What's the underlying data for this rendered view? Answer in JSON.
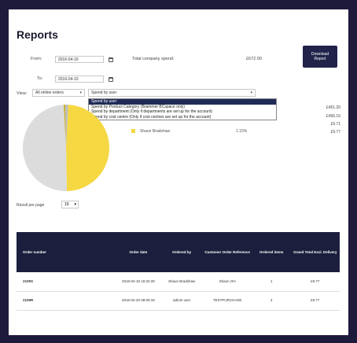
{
  "page": {
    "title": "Reports"
  },
  "filters": {
    "from_label": "From:",
    "from_value": "2016-04-10",
    "to_label": "To:",
    "to_value": "2016-04-10",
    "total_spend_label": "Total company spend:",
    "total_spend_value": "£672.00",
    "download_label": "Download Report",
    "view_label": "View:",
    "view_value": "All online orders",
    "spend_value": "Spend by user"
  },
  "dropdown": {
    "options": [
      "Spend by user",
      "Spend by Product Category (Brammer BCspace only)",
      "Spend by department (Only if departments are set up for the account)",
      "Spend by cost centre (Only if cost centres are set up for the account)"
    ],
    "selected_index": 0
  },
  "breakdown": {
    "amounts": [
      "£451.20",
      "£456.16",
      "£9.71",
      "£9.77"
    ],
    "legend_name": "Shaun Bradshaw",
    "legend_pct": "1.15%"
  },
  "chart_data": {
    "type": "pie",
    "slices": [
      {
        "label": "",
        "value": 48.9,
        "color": "#f5d842"
      },
      {
        "label": "",
        "value": 49.4,
        "color": "#dcdcdc"
      },
      {
        "label": "",
        "value": 0.6,
        "color": "#c9b32e"
      },
      {
        "label": "Shaun Bradshaw",
        "value": 1.1,
        "color": "#bdbdbd"
      }
    ]
  },
  "paging": {
    "label": "Result per page",
    "value": "10"
  },
  "table": {
    "headers": [
      "Order number",
      "Order date",
      "Ordered by",
      "Customer Order Reference",
      "Ordered items",
      "Grand Total Excl. Delivery"
    ],
    "rows": [
      [
        "2109S",
        "2016-02-16 15:32:28",
        "Shaun Bradshaw",
        "Shaun OH",
        "1",
        "£9.77"
      ],
      [
        "2109R",
        "2016-02-20 09:00:18",
        "admin user",
        "TESTPURCHASE",
        "4",
        "£9.77"
      ]
    ]
  },
  "colors": {
    "header_bg": "#1c1e3d",
    "accent": "#22234a",
    "highlight": "#1f2a57"
  }
}
